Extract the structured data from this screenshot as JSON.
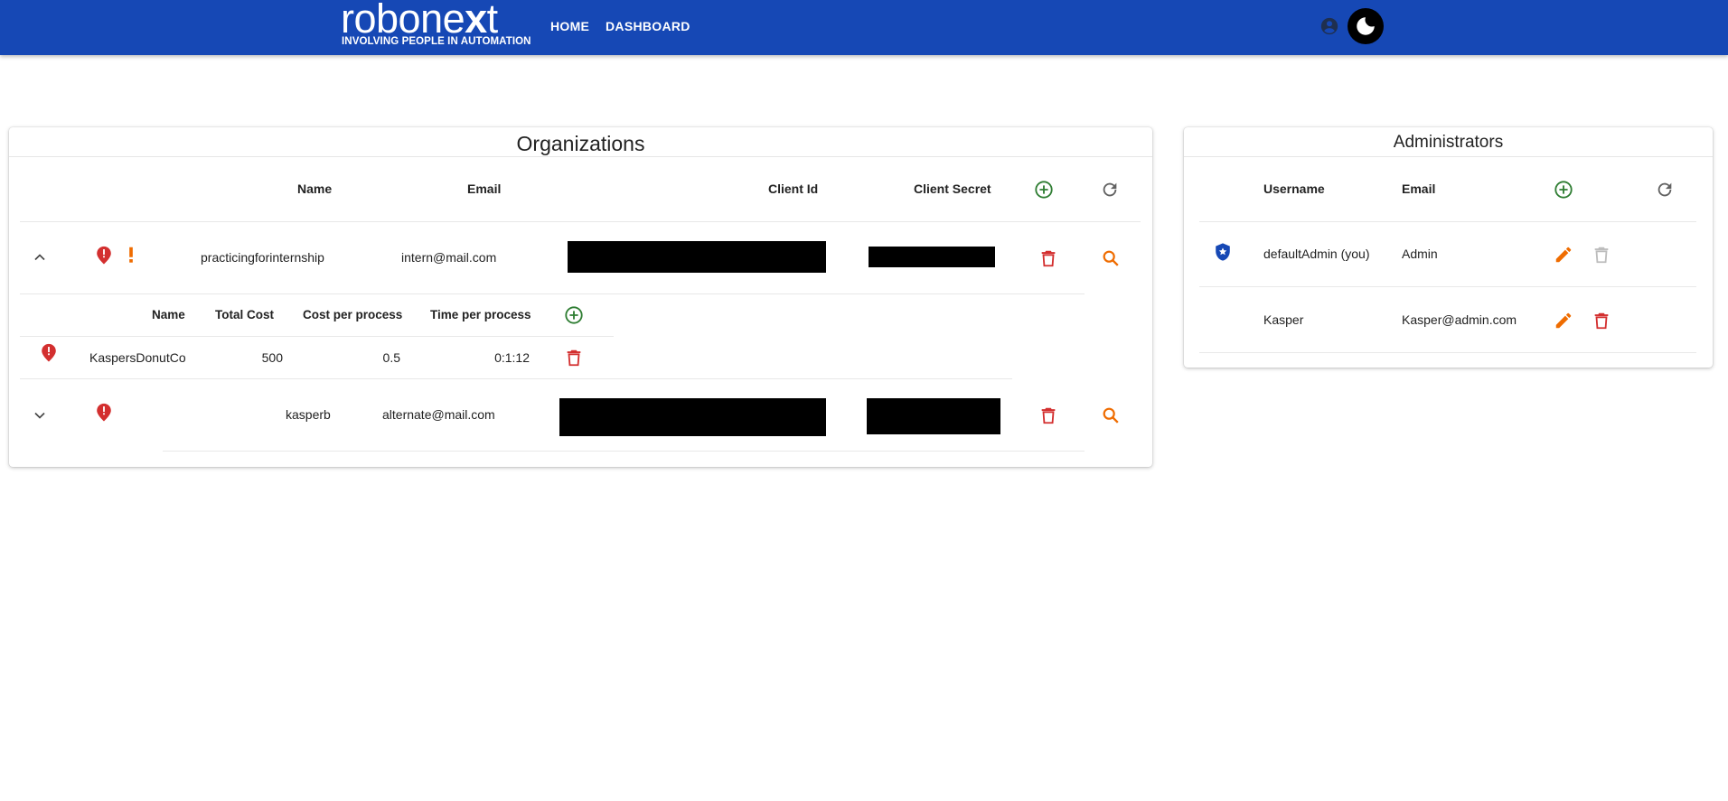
{
  "header": {
    "logo": {
      "main_a": "robone",
      "main_x": "x",
      "main_b": "t",
      "tagline": "INVOLVING PEOPLE IN AUTOMATION"
    },
    "nav": [
      {
        "label": "HOME"
      },
      {
        "label": "DASHBOARD"
      }
    ],
    "icons": {
      "account": "account-circle-icon",
      "theme": "dark-mode-moon-icon"
    }
  },
  "organizations": {
    "title": "Organizations",
    "columns": {
      "name": "Name",
      "email": "Email",
      "client_id": "Client Id",
      "client_secret": "Client Secret"
    },
    "rows": [
      {
        "name": "practicingforinternship",
        "email": "intern@mail.com",
        "expanded": true,
        "alerts": [
          "error-icon",
          "warning-exclamation-icon"
        ],
        "processes": {
          "columns": {
            "name": "Name",
            "total_cost": "Total Cost",
            "cost_per_process": "Cost per process",
            "time_per_process": "Time per process"
          },
          "rows": [
            {
              "name": "KaspersDonutCo",
              "total_cost": "500",
              "cost_per_process": "0.5",
              "time_per_process": "0:1:12"
            }
          ]
        }
      },
      {
        "name": "kasperb",
        "email": "alternate@mail.com",
        "expanded": false,
        "alerts": [
          "error-icon"
        ]
      }
    ]
  },
  "administrators": {
    "title": "Administrators",
    "columns": {
      "username": "Username",
      "email": "Email"
    },
    "rows": [
      {
        "username": "defaultAdmin (you)",
        "email": "Admin",
        "badge": "shield-star-icon",
        "delete_enabled": false
      },
      {
        "username": "Kasper",
        "email": "Kasper@admin.com",
        "delete_enabled": true
      }
    ]
  },
  "colors": {
    "appbar": "#1648b5",
    "add": "#2e7d32",
    "delete": "#d32f2f",
    "search_edit": "#ef6c00",
    "refresh": "#616161",
    "disabled": "#bdbdbd",
    "shield": "#1648b5"
  }
}
